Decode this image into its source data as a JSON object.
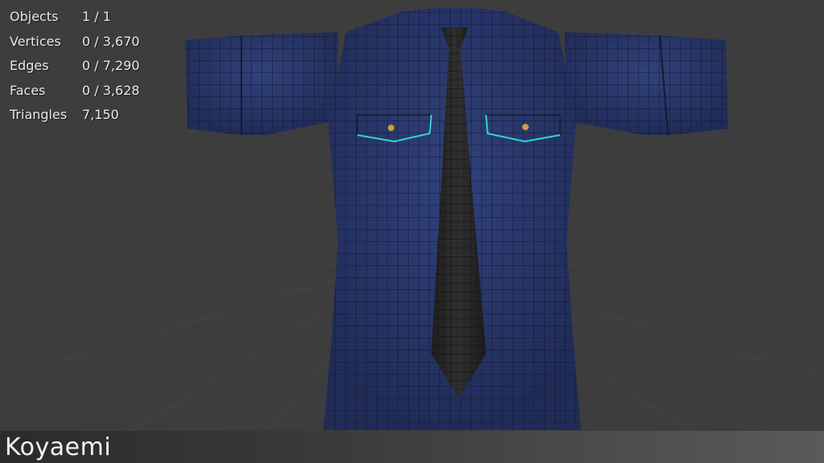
{
  "stats": {
    "objects_label": "Objects",
    "objects_value": "1 / 1",
    "vertices_label": "Vertices",
    "vertices_value": "0 / 3,670",
    "edges_label": "Edges",
    "edges_value": "0 / 7,290",
    "faces_label": "Faces",
    "faces_value": "0 / 3,628",
    "triangles_label": "Triangles",
    "triangles_value": "7,150"
  },
  "watermark": "Koyaemi",
  "colors": {
    "background": "#3d3d3d",
    "shirt": "#2c3a6e",
    "tie": "#2a2a2a",
    "seam_highlight": "#2fd6d6",
    "button": "#c9a13a"
  }
}
